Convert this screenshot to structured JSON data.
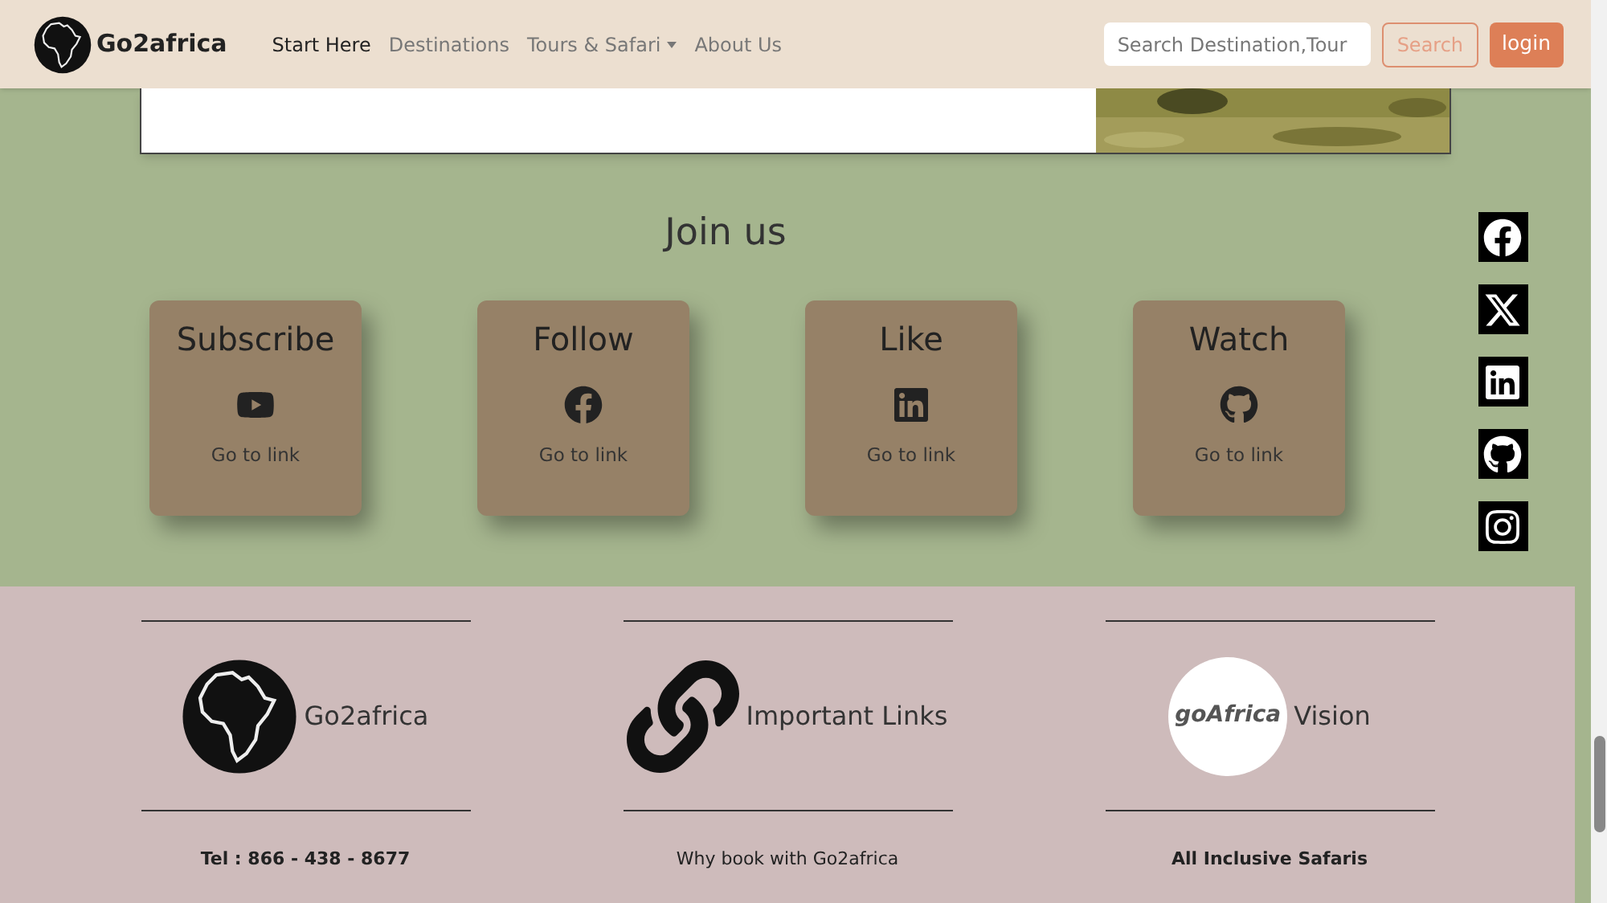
{
  "navbar": {
    "brand": "Go2africa",
    "links": [
      {
        "label": "Start Here",
        "selected": true,
        "dropdown": false
      },
      {
        "label": "Destinations",
        "selected": false,
        "dropdown": false
      },
      {
        "label": "Tours & Safari",
        "selected": false,
        "dropdown": true
      },
      {
        "label": "About Us",
        "selected": false,
        "dropdown": false
      }
    ],
    "search": {
      "placeholder": "Search Destination,Tour"
    },
    "search_button": "Search",
    "login_button": "login"
  },
  "join": {
    "title": "Join us",
    "cards": [
      {
        "title": "Subscribe",
        "link": "Go to link"
      },
      {
        "title": "Follow",
        "link": "Go to link"
      },
      {
        "title": "Like",
        "link": "Go to link"
      },
      {
        "title": "Watch",
        "link": "Go to link"
      }
    ]
  },
  "footer": {
    "columns": [
      {
        "title": "Go2africa",
        "item": "Tel : 866 - 438 - 8677",
        "bold": true
      },
      {
        "title": "Important Links",
        "item": "Why book with Go2africa",
        "bold": false
      },
      {
        "logo_text": "goAfrica",
        "title": "Vision",
        "item": "All Inclusive Safaris",
        "bold": true
      }
    ]
  }
}
